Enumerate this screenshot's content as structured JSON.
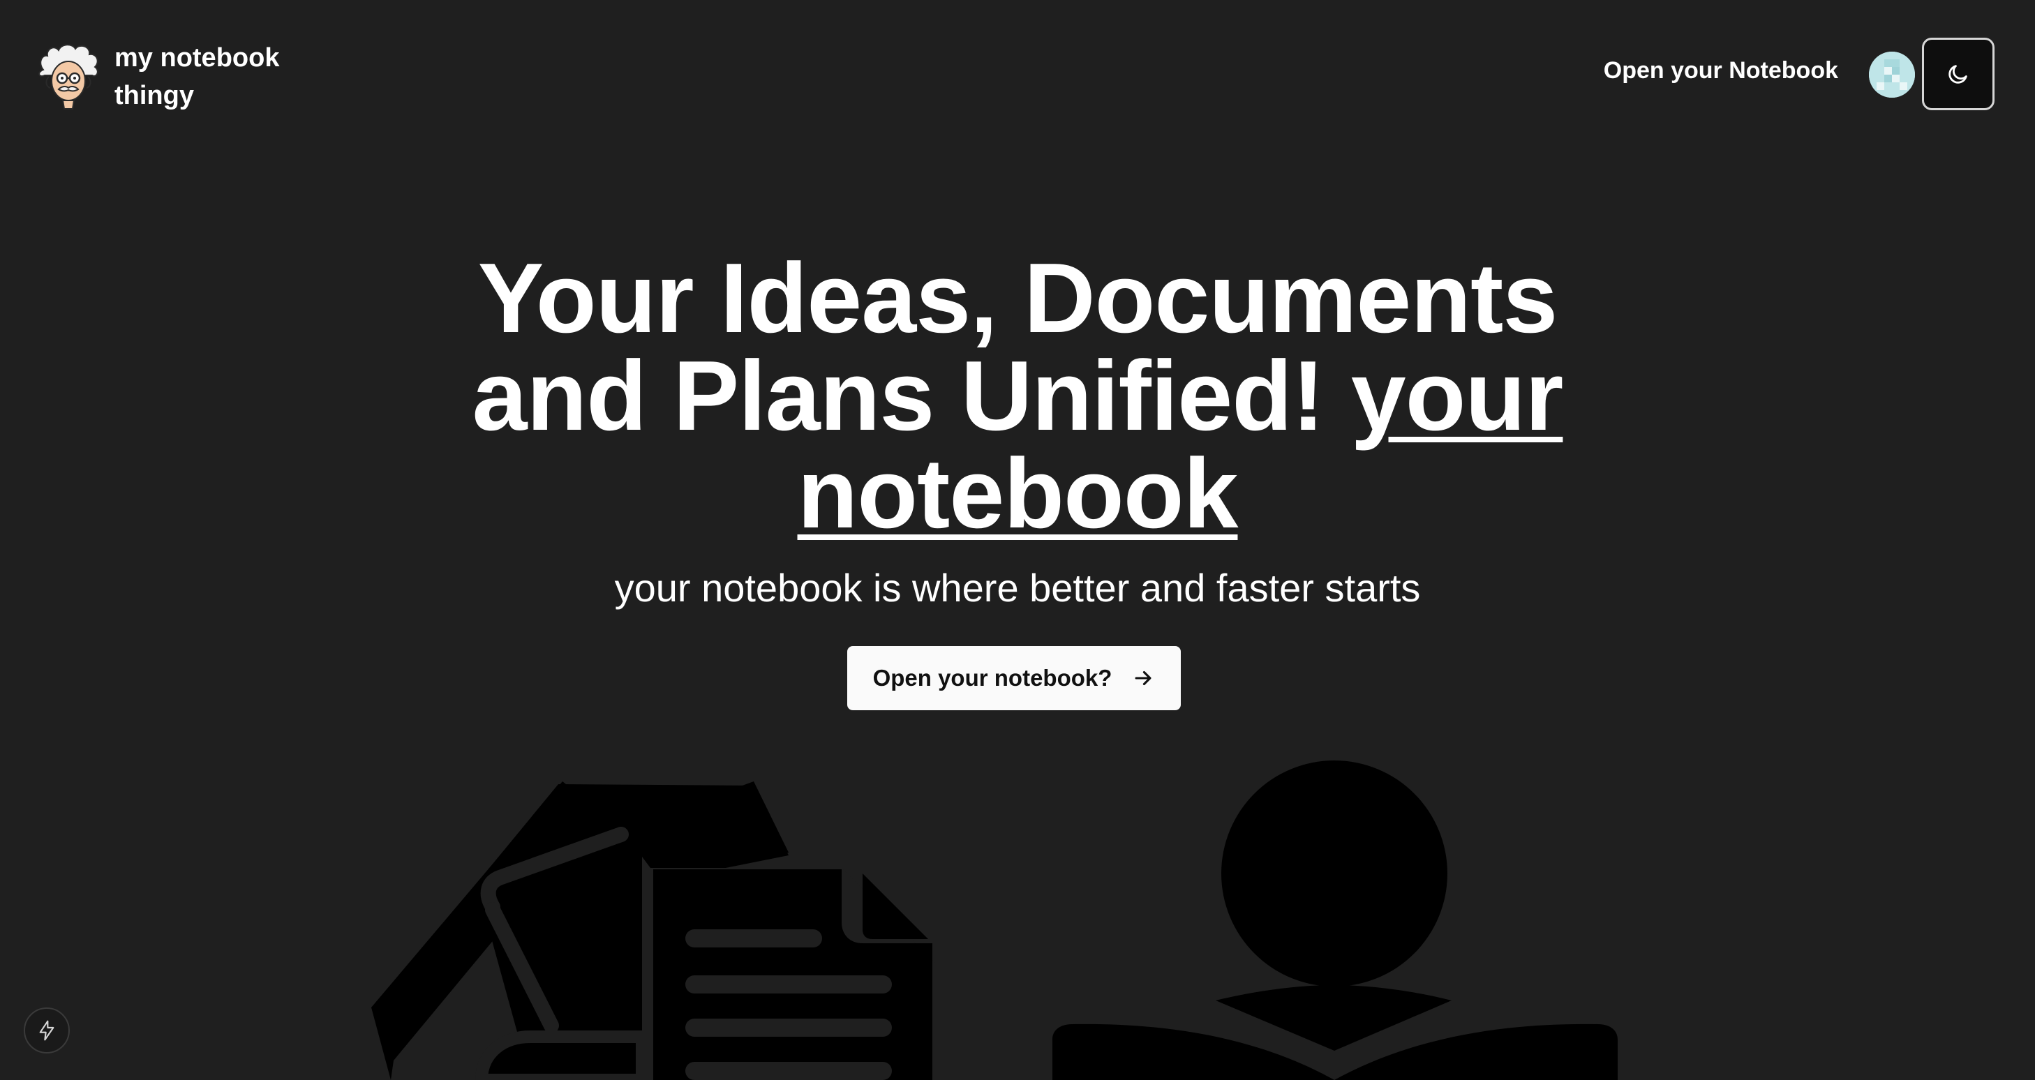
{
  "header": {
    "brand_name": "my notebook thingy",
    "logo_icon": "einstein-face-icon",
    "nav_link_label": "Open your Notebook",
    "avatar_icon": "user-avatar-icon",
    "theme_toggle_icon": "moon-icon"
  },
  "hero": {
    "title_part1": "Your Ideas, Documents and Plans Unified!",
    "title_part2": "your notebook",
    "subtitle": "your notebook is where better and faster starts",
    "cta_label": "Open your notebook?",
    "cta_icon": "arrow-right-icon"
  },
  "illustration": {
    "left_icon": "documents-icon",
    "right_icon": "person-reading-icon"
  },
  "footer": {
    "bolt_icon": "lightning-bolt-icon"
  },
  "colors": {
    "background": "#1f1f1f",
    "text": "#ffffff",
    "cta_background": "#fafafa",
    "illustration": "#000000"
  }
}
